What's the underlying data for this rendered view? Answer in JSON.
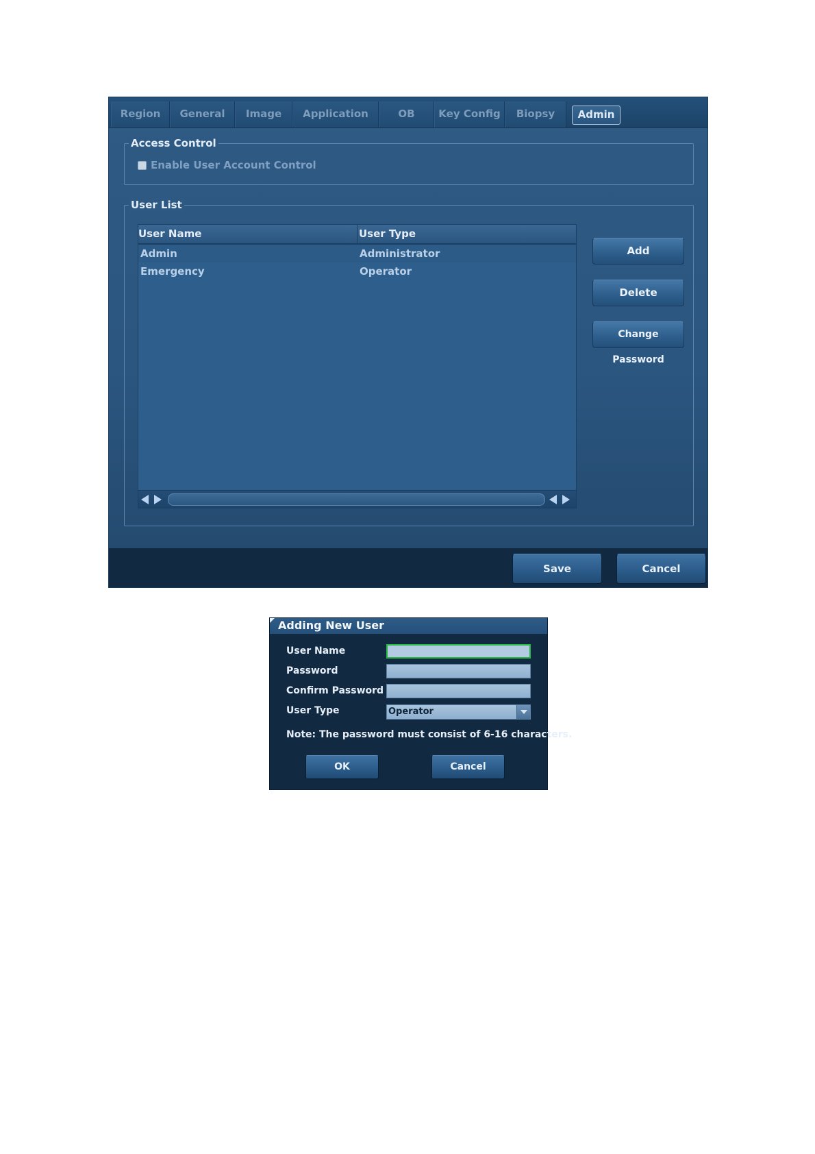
{
  "settings_window": {
    "tabs": [
      {
        "label": "Region",
        "active": false
      },
      {
        "label": "General",
        "active": false
      },
      {
        "label": "Image",
        "active": false
      },
      {
        "label": "Application",
        "active": false
      },
      {
        "label": "OB",
        "active": false
      },
      {
        "label": "Key Config",
        "active": false
      },
      {
        "label": "Biopsy",
        "active": false
      },
      {
        "label": "Admin",
        "active": true
      }
    ],
    "access_control": {
      "legend": "Access Control",
      "enable_uac_label": "Enable User Account Control",
      "enable_uac_checked": false
    },
    "user_list": {
      "legend": "User List",
      "columns": [
        "User Name",
        "User Type"
      ],
      "rows": [
        {
          "name": "Admin",
          "type": "Administrator"
        },
        {
          "name": "Emergency",
          "type": "Operator"
        }
      ]
    },
    "side_buttons": {
      "add": "Add",
      "delete": "Delete",
      "change_password": "Change Password"
    },
    "footer": {
      "save": "Save",
      "cancel": "Cancel"
    }
  },
  "dialog": {
    "title": "Adding New User",
    "fields": {
      "user_name_label": "User Name",
      "user_name_value": "",
      "password_label": "Password",
      "password_value": "",
      "confirm_password_label": "Confirm Password",
      "confirm_password_value": "",
      "user_type_label": "User Type",
      "user_type_value": "Operator"
    },
    "note": "Note: The password must consist of 6-16 characters.",
    "buttons": {
      "ok": "OK",
      "cancel": "Cancel"
    }
  },
  "colors": {
    "window_bg": "#2d5983",
    "footer_bg": "#112a41",
    "focus_border": "#27b83f"
  },
  "icons": [
    "checkbox-icon",
    "scroll-left-icon",
    "scroll-right-icon",
    "dropdown-arrow-icon"
  ]
}
